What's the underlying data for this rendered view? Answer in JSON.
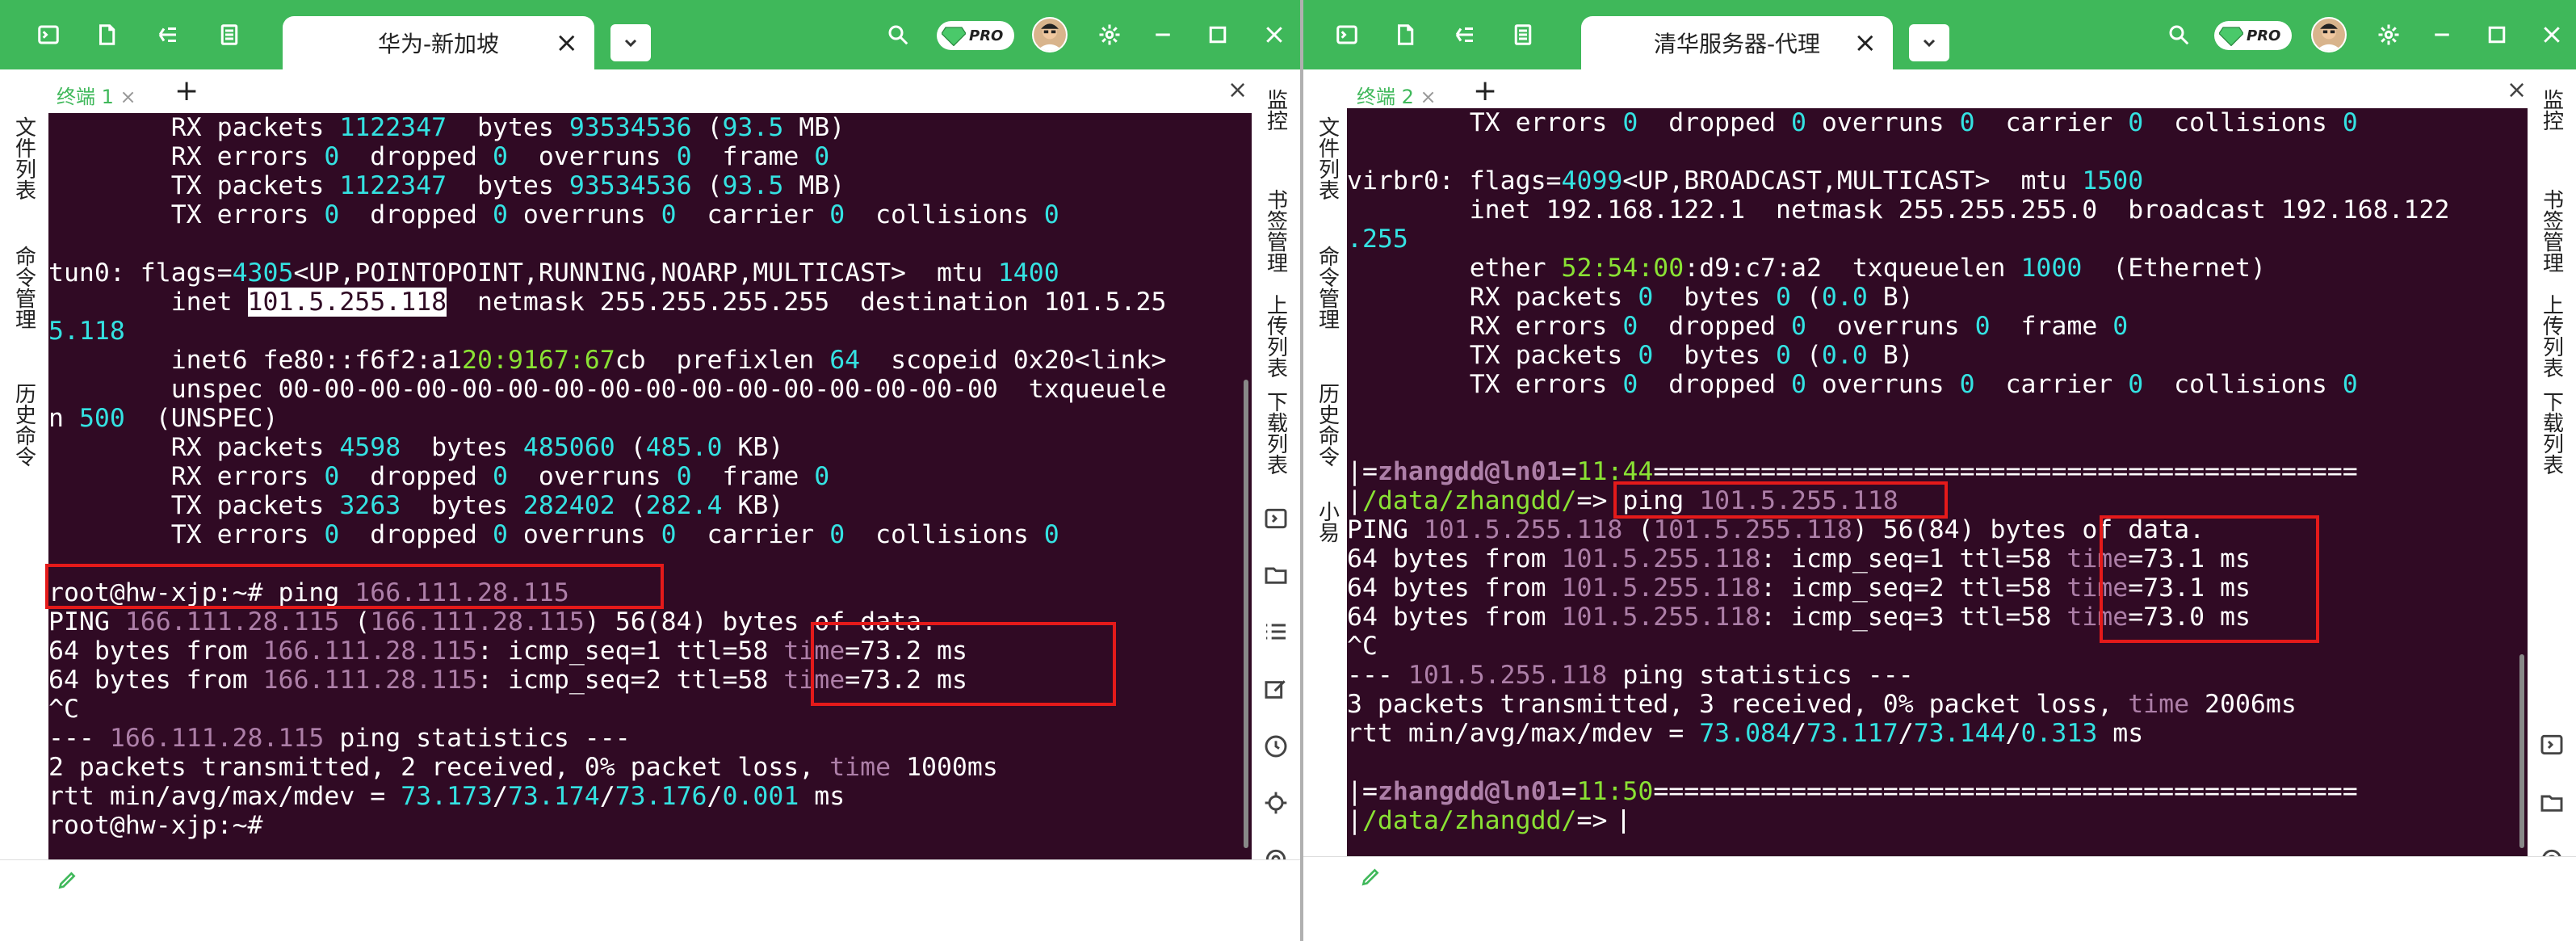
{
  "left": {
    "tab_title": "华为-新加坡",
    "subtab_label": "终端 1",
    "side_left": [
      "文件列表",
      "命令管理",
      "历史命令"
    ],
    "side_right": [
      "监控",
      "书签管理",
      "上传列表",
      "下载列表"
    ],
    "terminal_lines": [
      [
        [
          "w",
          "        RX packets "
        ],
        [
          "c",
          "1122347"
        ],
        [
          "w",
          "  bytes "
        ],
        [
          "c",
          "93534536"
        ],
        [
          "w",
          " ("
        ],
        [
          "c",
          "93.5"
        ],
        [
          "w",
          " MB)"
        ]
      ],
      [
        [
          "w",
          "        RX errors "
        ],
        [
          "c",
          "0"
        ],
        [
          "w",
          "  dropped "
        ],
        [
          "c",
          "0"
        ],
        [
          "w",
          "  overruns "
        ],
        [
          "c",
          "0"
        ],
        [
          "w",
          "  frame "
        ],
        [
          "c",
          "0"
        ]
      ],
      [
        [
          "w",
          "        TX packets "
        ],
        [
          "c",
          "1122347"
        ],
        [
          "w",
          "  bytes "
        ],
        [
          "c",
          "93534536"
        ],
        [
          "w",
          " ("
        ],
        [
          "c",
          "93.5"
        ],
        [
          "w",
          " MB)"
        ]
      ],
      [
        [
          "w",
          "        TX errors "
        ],
        [
          "c",
          "0"
        ],
        [
          "w",
          "  dropped "
        ],
        [
          "c",
          "0"
        ],
        [
          "w",
          " overruns "
        ],
        [
          "c",
          "0"
        ],
        [
          "w",
          "  carrier "
        ],
        [
          "c",
          "0"
        ],
        [
          "w",
          "  collisions "
        ],
        [
          "c",
          "0"
        ]
      ],
      [
        [
          "w",
          ""
        ]
      ],
      [
        [
          "w",
          "tun0: flags="
        ],
        [
          "c",
          "4305"
        ],
        [
          "w",
          "<UP,POINTOPOINT,RUNNING,NOARP,MULTICAST>  mtu "
        ],
        [
          "c",
          "1400"
        ]
      ],
      [
        [
          "w",
          "        inet "
        ],
        [
          "h",
          "101.5.255.118"
        ],
        [
          "w",
          "  netmask 255.255.255.255  destination 101.5.25"
        ]
      ],
      [
        [
          "c",
          "5.118"
        ]
      ],
      [
        [
          "w",
          "        inet6 fe80::f6f2:a1"
        ],
        [
          "g",
          "20:9167:67"
        ],
        [
          "w",
          "cb  prefixlen "
        ],
        [
          "c",
          "64"
        ],
        [
          "w",
          "  scopeid 0x20<link>"
        ]
      ],
      [
        [
          "w",
          "        unspec 00-00-00-00-00-00-00-00-00-00-00-00-00-00-00-00  txqueuele"
        ]
      ],
      [
        [
          "w",
          "n "
        ],
        [
          "c",
          "500"
        ],
        [
          "w",
          "  (UNSPEC)"
        ]
      ],
      [
        [
          "w",
          "        RX packets "
        ],
        [
          "c",
          "4598"
        ],
        [
          "w",
          "  bytes "
        ],
        [
          "c",
          "485060"
        ],
        [
          "w",
          " ("
        ],
        [
          "c",
          "485.0"
        ],
        [
          "w",
          " KB)"
        ]
      ],
      [
        [
          "w",
          "        RX errors "
        ],
        [
          "c",
          "0"
        ],
        [
          "w",
          "  dropped "
        ],
        [
          "c",
          "0"
        ],
        [
          "w",
          "  overruns "
        ],
        [
          "c",
          "0"
        ],
        [
          "w",
          "  frame "
        ],
        [
          "c",
          "0"
        ]
      ],
      [
        [
          "w",
          "        TX packets "
        ],
        [
          "c",
          "3263"
        ],
        [
          "w",
          "  bytes "
        ],
        [
          "c",
          "282402"
        ],
        [
          "w",
          " ("
        ],
        [
          "c",
          "282.4"
        ],
        [
          "w",
          " KB)"
        ]
      ],
      [
        [
          "w",
          "        TX errors "
        ],
        [
          "c",
          "0"
        ],
        [
          "w",
          "  dropped "
        ],
        [
          "c",
          "0"
        ],
        [
          "w",
          " overruns "
        ],
        [
          "c",
          "0"
        ],
        [
          "w",
          "  carrier "
        ],
        [
          "c",
          "0"
        ],
        [
          "w",
          "  collisions "
        ],
        [
          "c",
          "0"
        ]
      ],
      [
        [
          "w",
          ""
        ]
      ],
      [
        [
          "w",
          "root@hw-xjp:~# ping "
        ],
        [
          "m",
          "166.111.28.115"
        ]
      ],
      [
        [
          "w",
          "PING "
        ],
        [
          "m",
          "166.111.28.115"
        ],
        [
          "w",
          " ("
        ],
        [
          "m",
          "166.111.28.115"
        ],
        [
          "w",
          ") 56(84) bytes of data."
        ]
      ],
      [
        [
          "w",
          "64 bytes from "
        ],
        [
          "m",
          "166.111.28.115"
        ],
        [
          "w",
          ": icmp_seq=1 ttl=58 "
        ],
        [
          "m",
          "time"
        ],
        [
          "w",
          "=73.2 ms"
        ]
      ],
      [
        [
          "w",
          "64 bytes from "
        ],
        [
          "m",
          "166.111.28.115"
        ],
        [
          "w",
          ": icmp_seq=2 ttl=58 "
        ],
        [
          "m",
          "time"
        ],
        [
          "w",
          "=73.2 ms"
        ]
      ],
      [
        [
          "w",
          "^C"
        ]
      ],
      [
        [
          "w",
          "--- "
        ],
        [
          "m",
          "166.111.28.115"
        ],
        [
          "w",
          " ping statistics ---"
        ]
      ],
      [
        [
          "w",
          "2 packets transmitted, 2 received, 0% packet loss, "
        ],
        [
          "m",
          "time"
        ],
        [
          "w",
          " 1000ms"
        ]
      ],
      [
        [
          "w",
          "rtt min/avg/max/mdev = "
        ],
        [
          "c",
          "73.173"
        ],
        [
          "w",
          "/"
        ],
        [
          "c",
          "73.174"
        ],
        [
          "w",
          "/"
        ],
        [
          "c",
          "73.176"
        ],
        [
          "w",
          "/"
        ],
        [
          "c",
          "0.001"
        ],
        [
          "w",
          " ms"
        ]
      ],
      [
        [
          "w",
          "root@hw-xjp:~#"
        ]
      ]
    ]
  },
  "right": {
    "tab_title": "清华服务器-代理",
    "subtab_label": "终端 2",
    "side_left": [
      "文件列表",
      "命令管理",
      "历史命令",
      "小易"
    ],
    "side_right": [
      "监控",
      "书签管理",
      "上传列表",
      "下载列表"
    ],
    "terminal_lines": [
      [
        [
          "w",
          "        TX errors "
        ],
        [
          "c",
          "0"
        ],
        [
          "w",
          "  dropped "
        ],
        [
          "c",
          "0"
        ],
        [
          "w",
          " overruns "
        ],
        [
          "c",
          "0"
        ],
        [
          "w",
          "  carrier "
        ],
        [
          "c",
          "0"
        ],
        [
          "w",
          "  collisions "
        ],
        [
          "c",
          "0"
        ]
      ],
      [
        [
          "w",
          ""
        ]
      ],
      [
        [
          "w",
          "virbr0: flags="
        ],
        [
          "c",
          "4099"
        ],
        [
          "w",
          "<UP,BROADCAST,MULTICAST>  mtu "
        ],
        [
          "c",
          "1500"
        ]
      ],
      [
        [
          "w",
          "        inet 192.168.122.1  netmask 255.255.255.0  broadcast 192.168.122"
        ]
      ],
      [
        [
          "c",
          ".255"
        ]
      ],
      [
        [
          "w",
          "        ether "
        ],
        [
          "g",
          "52:54:00"
        ],
        [
          "w",
          ":d9:c7:a2  txqueuelen "
        ],
        [
          "c",
          "1000"
        ],
        [
          "w",
          "  (Ethernet)"
        ]
      ],
      [
        [
          "w",
          "        RX packets "
        ],
        [
          "c",
          "0"
        ],
        [
          "w",
          "  bytes "
        ],
        [
          "c",
          "0"
        ],
        [
          "w",
          " ("
        ],
        [
          "c",
          "0.0"
        ],
        [
          "w",
          " B)"
        ]
      ],
      [
        [
          "w",
          "        RX errors "
        ],
        [
          "c",
          "0"
        ],
        [
          "w",
          "  dropped "
        ],
        [
          "c",
          "0"
        ],
        [
          "w",
          "  overruns "
        ],
        [
          "c",
          "0"
        ],
        [
          "w",
          "  frame "
        ],
        [
          "c",
          "0"
        ]
      ],
      [
        [
          "w",
          "        TX packets "
        ],
        [
          "c",
          "0"
        ],
        [
          "w",
          "  bytes "
        ],
        [
          "c",
          "0"
        ],
        [
          "w",
          " ("
        ],
        [
          "c",
          "0.0"
        ],
        [
          "w",
          " B)"
        ]
      ],
      [
        [
          "w",
          "        TX errors "
        ],
        [
          "c",
          "0"
        ],
        [
          "w",
          "  dropped "
        ],
        [
          "c",
          "0"
        ],
        [
          "w",
          " overruns "
        ],
        [
          "c",
          "0"
        ],
        [
          "w",
          "  carrier "
        ],
        [
          "c",
          "0"
        ],
        [
          "w",
          "  collisions "
        ],
        [
          "c",
          "0"
        ]
      ],
      [
        [
          "w",
          ""
        ]
      ],
      [
        [
          "w",
          ""
        ]
      ],
      [
        [
          "w",
          "|="
        ],
        [
          "pm",
          "zhangdd@ln01"
        ],
        [
          "w",
          "="
        ],
        [
          "g",
          "11:44"
        ],
        [
          "w",
          "=============================================="
        ]
      ],
      [
        [
          "w",
          "|"
        ],
        [
          "g",
          "/data/zhangdd/"
        ],
        [
          "w",
          "=> ping "
        ],
        [
          "m",
          "101.5.255.118"
        ]
      ],
      [
        [
          "w",
          "PING "
        ],
        [
          "m",
          "101.5.255.118"
        ],
        [
          "w",
          " ("
        ],
        [
          "m",
          "101.5.255.118"
        ],
        [
          "w",
          ") 56(84) bytes of data."
        ]
      ],
      [
        [
          "w",
          "64 bytes from "
        ],
        [
          "m",
          "101.5.255.118"
        ],
        [
          "w",
          ": icmp_seq=1 ttl=58 "
        ],
        [
          "m",
          "time"
        ],
        [
          "w",
          "=73.1 ms"
        ]
      ],
      [
        [
          "w",
          "64 bytes from "
        ],
        [
          "m",
          "101.5.255.118"
        ],
        [
          "w",
          ": icmp_seq=2 ttl=58 "
        ],
        [
          "m",
          "time"
        ],
        [
          "w",
          "=73.1 ms"
        ]
      ],
      [
        [
          "w",
          "64 bytes from "
        ],
        [
          "m",
          "101.5.255.118"
        ],
        [
          "w",
          ": icmp_seq=3 ttl=58 "
        ],
        [
          "m",
          "time"
        ],
        [
          "w",
          "=73.0 ms"
        ]
      ],
      [
        [
          "w",
          "^C"
        ]
      ],
      [
        [
          "w",
          "--- "
        ],
        [
          "m",
          "101.5.255.118"
        ],
        [
          "w",
          " ping statistics ---"
        ]
      ],
      [
        [
          "w",
          "3 packets transmitted, 3 received, 0% packet loss, "
        ],
        [
          "m",
          "time"
        ],
        [
          "w",
          " 2006ms"
        ]
      ],
      [
        [
          "w",
          "rtt min/avg/max/mdev = "
        ],
        [
          "c",
          "73.084"
        ],
        [
          "w",
          "/"
        ],
        [
          "c",
          "73.117"
        ],
        [
          "w",
          "/"
        ],
        [
          "c",
          "73.144"
        ],
        [
          "w",
          "/"
        ],
        [
          "c",
          "0.313"
        ],
        [
          "w",
          " ms"
        ]
      ],
      [
        [
          "w",
          ""
        ]
      ],
      [
        [
          "w",
          "|="
        ],
        [
          "pm",
          "zhangdd@ln01"
        ],
        [
          "w",
          "="
        ],
        [
          "g",
          "11:50"
        ],
        [
          "w",
          "=============================================="
        ]
      ],
      [
        [
          "w",
          "|"
        ],
        [
          "g",
          "/data/zhangdd/"
        ],
        [
          "w",
          "=> "
        ]
      ]
    ]
  },
  "toolbar_icons": [
    "terminal-icon",
    "file-icon",
    "sftp-icon",
    "list-icon"
  ],
  "badge": "PRO"
}
